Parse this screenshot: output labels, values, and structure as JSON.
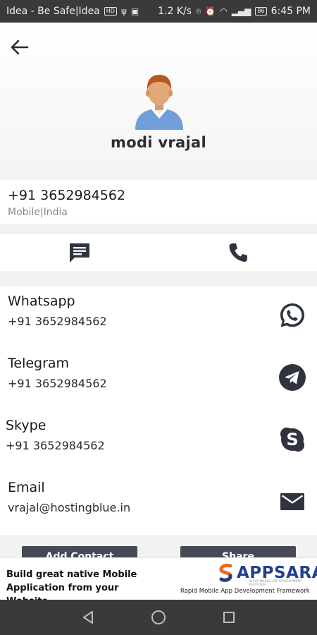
{
  "status_bar": {
    "carrier": "Idea - Be Safe|Idea",
    "hd_badge": "HD",
    "speed": "1.2 K/s",
    "battery": "86",
    "time": "6:45 PM"
  },
  "contact": {
    "name": "modi vrajal",
    "phone": "+91 3652984562",
    "phone_type": "Mobile|India"
  },
  "actions": {
    "message_icon": "message-icon",
    "call_icon": "phone-icon"
  },
  "cards": [
    {
      "title": "Whatsapp",
      "value": "+91 3652984562",
      "icon": "whatsapp-icon"
    },
    {
      "title": "Telegram",
      "value": "+91 3652984562",
      "icon": "telegram-icon"
    },
    {
      "title": "Skype",
      "value": "+91 3652984562",
      "icon": "skype-icon"
    },
    {
      "title": "Email",
      "value": "vrajal@hostingblue.in",
      "icon": "email-icon"
    }
  ],
  "buttons": {
    "add_contact": "Add Contact",
    "share": "Share"
  },
  "banner": {
    "text": "Build great native Mobile Application from your Website.",
    "brand_name": "APPSARA",
    "brand_small": "BUILD MOBILE APP DEVELOPMENT PLATFORM",
    "tagline": "Rapid Mobile App Development Framework"
  },
  "colors": {
    "accent_dark": "#454a56",
    "brand_blue": "#233f8f",
    "brand_orange": "#ea6b1f"
  }
}
